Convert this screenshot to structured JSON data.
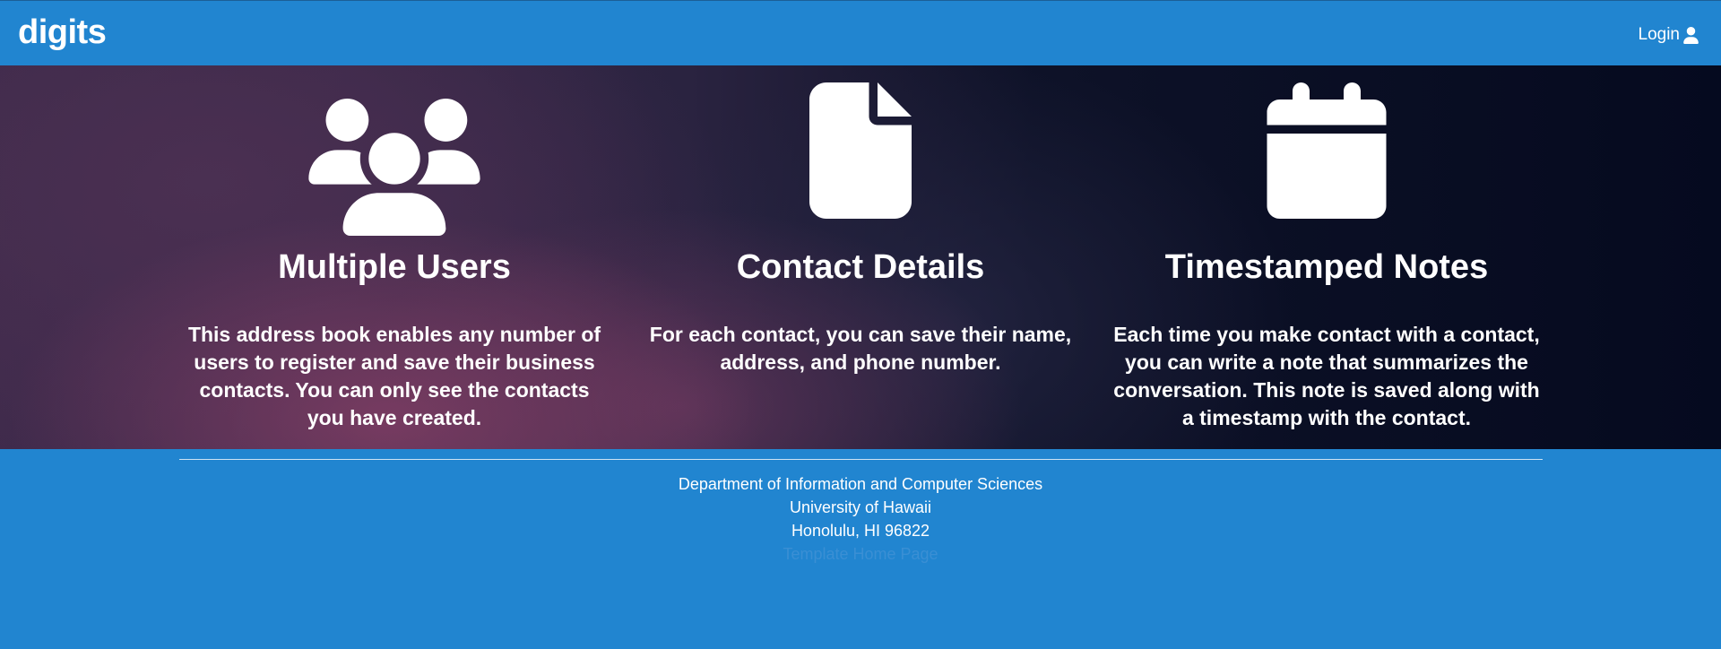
{
  "navbar": {
    "brand": "digits",
    "login_label": "Login",
    "login_icon": "user-icon"
  },
  "features": [
    {
      "icon": "users-icon",
      "title": "Multiple Users",
      "description": "This address book enables any number of users to register and save their business contacts. You can only see the contacts you have created."
    },
    {
      "icon": "file-icon",
      "title": "Contact Details",
      "description": "For each contact, you can save their name, address, and phone number."
    },
    {
      "icon": "calendar-icon",
      "title": "Timestamped Notes",
      "description": "Each time you make contact with a contact, you can write a note that summarizes the conversation. This note is saved along with a timestamp with the contact."
    }
  ],
  "footer": {
    "line1": "Department of Information and Computer Sciences",
    "line2": "University of Hawaii",
    "line3": "Honolulu, HI 96822",
    "link": "Template Home Page"
  },
  "colors": {
    "primary": "#2185d0",
    "hero_dark": "#050a1f",
    "hero_purple": "#803e64",
    "text": "#ffffff"
  }
}
